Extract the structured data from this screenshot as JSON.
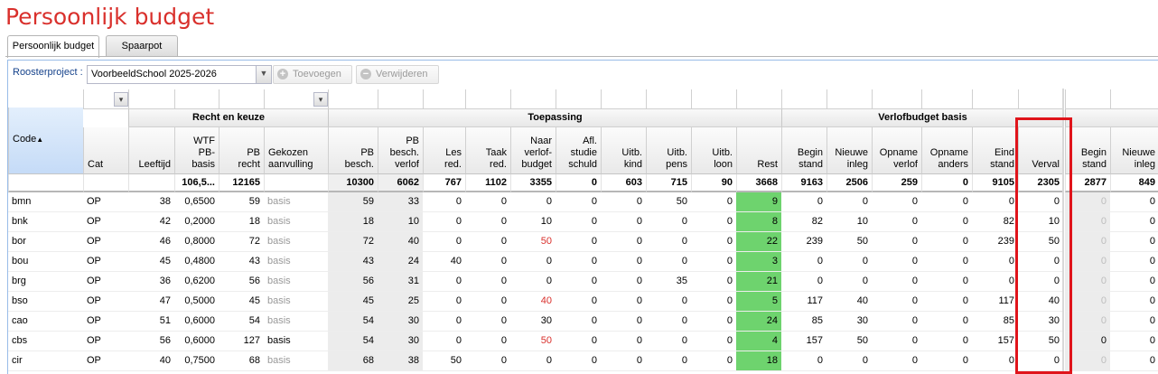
{
  "page": {
    "title": "Persoonlijk budget"
  },
  "tabs": [
    {
      "label": "Persoonlijk budget",
      "active": true
    },
    {
      "label": "Spaarpot",
      "active": false
    }
  ],
  "toolbar": {
    "roosterproject_label": "Roosterproject :",
    "roosterproject_value": "VoorbeeldSchool 2025-2026",
    "add_label": "Toevoegen",
    "remove_label": "Verwijderen"
  },
  "groups": {
    "recht": "Recht en keuze",
    "toepassing": "Toepassing",
    "verlof": "Verlofbudget basis"
  },
  "columns": {
    "code": "Code",
    "cat": "Cat",
    "leeftijd": "Leeftijd",
    "wtf": "WTF\nPB-\nbasis",
    "pbrecht": "PB\nrecht",
    "gekozen": "Gekozen\naanvulling",
    "pbbesch": "PB\nbesch.",
    "pbbeschverlof": "PB\nbesch.\nverlof",
    "lesred": "Les\nred.",
    "taakred": "Taak\nred.",
    "naarverlof": "Naar\nverlof-\nbudget",
    "aflstudie": "Afl.\nstudie\nschuld",
    "uitbkind": "Uitb.\nkind",
    "uitbpens": "Uitb.\npens",
    "uitbloon": "Uitb.\nloon",
    "rest": "Rest",
    "beginstand": "Begin\nstand",
    "nieuweinleg": "Nieuwe\ninleg",
    "opnameverlof": "Opname\nverlof",
    "opnameanders": "Opname\nanders",
    "eindstand": "Eind\nstand",
    "verval": "Verval",
    "beginstand2": "Begin\nstand",
    "nieuweinleg2": "Nieuwe\ninleg"
  },
  "totals": {
    "wtf": "106,5...",
    "pbrecht": "12165",
    "pbbesch": "10300",
    "pbbeschverlof": "6062",
    "lesred": "767",
    "taakred": "1102",
    "naarverlof": "3355",
    "aflstudie": "0",
    "uitbkind": "603",
    "uitbpens": "715",
    "uitbloon": "90",
    "rest": "3668",
    "beginstand": "9163",
    "nieuweinleg": "2506",
    "opnameverlof": "259",
    "opnameanders": "0",
    "eindstand": "9105",
    "verval": "2305",
    "beginstand2": "2877",
    "nieuweinleg2": "849"
  },
  "rows": [
    {
      "code": "bmn",
      "cat": "OP",
      "leeftijd": "38",
      "wtf": "0,6500",
      "pbrecht": "59",
      "gekozen": "basis",
      "pbbesch": "59",
      "pbbeschverlof": "33",
      "lesred": "0",
      "taakred": "0",
      "naarverlof": "0",
      "aflstudie": "0",
      "uitbkind": "0",
      "uitbpens": "50",
      "uitbloon": "0",
      "rest": "9",
      "beginstand": "0",
      "nieuweinleg": "0",
      "opnameverlof": "0",
      "opnameanders": "0",
      "eindstand": "0",
      "verval": "0",
      "beginstand2": "0",
      "nieuweinleg2": "0"
    },
    {
      "code": "bnk",
      "cat": "OP",
      "leeftijd": "42",
      "wtf": "0,2000",
      "pbrecht": "18",
      "gekozen": "basis",
      "pbbesch": "18",
      "pbbeschverlof": "10",
      "lesred": "0",
      "taakred": "0",
      "naarverlof": "10",
      "aflstudie": "0",
      "uitbkind": "0",
      "uitbpens": "0",
      "uitbloon": "0",
      "rest": "8",
      "beginstand": "82",
      "nieuweinleg": "10",
      "opnameverlof": "0",
      "opnameanders": "0",
      "eindstand": "82",
      "verval": "10",
      "beginstand2": "0",
      "nieuweinleg2": "0"
    },
    {
      "code": "bor",
      "cat": "OP",
      "leeftijd": "46",
      "wtf": "0,8000",
      "pbrecht": "72",
      "gekozen": "basis",
      "pbbesch": "72",
      "pbbeschverlof": "40",
      "lesred": "0",
      "taakred": "0",
      "naarverlof": "50",
      "aflstudie": "0",
      "uitbkind": "0",
      "uitbpens": "0",
      "uitbloon": "0",
      "rest": "22",
      "beginstand": "239",
      "nieuweinleg": "50",
      "opnameverlof": "0",
      "opnameanders": "0",
      "eindstand": "239",
      "verval": "50",
      "beginstand2": "0",
      "nieuweinleg2": "0"
    },
    {
      "code": "bou",
      "cat": "OP",
      "leeftijd": "45",
      "wtf": "0,4800",
      "pbrecht": "43",
      "gekozen": "basis",
      "pbbesch": "43",
      "pbbeschverlof": "24",
      "lesred": "40",
      "taakred": "0",
      "naarverlof": "0",
      "aflstudie": "0",
      "uitbkind": "0",
      "uitbpens": "0",
      "uitbloon": "0",
      "rest": "3",
      "beginstand": "0",
      "nieuweinleg": "0",
      "opnameverlof": "0",
      "opnameanders": "0",
      "eindstand": "0",
      "verval": "0",
      "beginstand2": "0",
      "nieuweinleg2": "0"
    },
    {
      "code": "brg",
      "cat": "OP",
      "leeftijd": "36",
      "wtf": "0,6200",
      "pbrecht": "56",
      "gekozen": "basis",
      "pbbesch": "56",
      "pbbeschverlof": "31",
      "lesred": "0",
      "taakred": "0",
      "naarverlof": "0",
      "aflstudie": "0",
      "uitbkind": "0",
      "uitbpens": "35",
      "uitbloon": "0",
      "rest": "21",
      "beginstand": "0",
      "nieuweinleg": "0",
      "opnameverlof": "0",
      "opnameanders": "0",
      "eindstand": "0",
      "verval": "0",
      "beginstand2": "0",
      "nieuweinleg2": "0"
    },
    {
      "code": "bso",
      "cat": "OP",
      "leeftijd": "47",
      "wtf": "0,5000",
      "pbrecht": "45",
      "gekozen": "basis",
      "pbbesch": "45",
      "pbbeschverlof": "25",
      "lesred": "0",
      "taakred": "0",
      "naarverlof": "40",
      "aflstudie": "0",
      "uitbkind": "0",
      "uitbpens": "0",
      "uitbloon": "0",
      "rest": "5",
      "beginstand": "117",
      "nieuweinleg": "40",
      "opnameverlof": "0",
      "opnameanders": "0",
      "eindstand": "117",
      "verval": "40",
      "beginstand2": "0",
      "nieuweinleg2": "0"
    },
    {
      "code": "cao",
      "cat": "OP",
      "leeftijd": "51",
      "wtf": "0,6000",
      "pbrecht": "54",
      "gekozen": "basis",
      "pbbesch": "54",
      "pbbeschverlof": "30",
      "lesred": "0",
      "taakred": "0",
      "naarverlof": "30",
      "aflstudie": "0",
      "uitbkind": "0",
      "uitbpens": "0",
      "uitbloon": "0",
      "rest": "24",
      "beginstand": "85",
      "nieuweinleg": "30",
      "opnameverlof": "0",
      "opnameanders": "0",
      "eindstand": "85",
      "verval": "30",
      "beginstand2": "0",
      "nieuweinleg2": "0"
    },
    {
      "code": "cbs",
      "cat": "OP",
      "leeftijd": "56",
      "wtf": "0,6000",
      "pbrecht": "127",
      "gekozen": "basis",
      "pbbesch": "54",
      "pbbeschverlof": "30",
      "lesred": "0",
      "taakred": "0",
      "naarverlof": "50",
      "aflstudie": "0",
      "uitbkind": "0",
      "uitbpens": "0",
      "uitbloon": "0",
      "rest": "4",
      "beginstand": "157",
      "nieuweinleg": "50",
      "opnameverlof": "0",
      "opnameanders": "0",
      "eindstand": "157",
      "verval": "50",
      "beginstand2": "0",
      "nieuweinleg2": "0"
    },
    {
      "code": "cir",
      "cat": "OP",
      "leeftijd": "40",
      "wtf": "0,7500",
      "pbrecht": "68",
      "gekozen": "basis",
      "pbbesch": "68",
      "pbbeschverlof": "38",
      "lesred": "50",
      "taakred": "0",
      "naarverlof": "0",
      "aflstudie": "0",
      "uitbkind": "0",
      "uitbpens": "0",
      "uitbloon": "0",
      "rest": "18",
      "beginstand": "0",
      "nieuweinleg": "0",
      "opnameverlof": "0",
      "opnameanders": "0",
      "eindstand": "0",
      "verval": "0",
      "beginstand2": "0",
      "nieuweinleg2": "0"
    }
  ],
  "colors": {
    "title": "#d9302c",
    "rest_fill": "#6ed36e",
    "positive_naar_verlof": "#d9302c",
    "highlight": "#e0141b"
  }
}
